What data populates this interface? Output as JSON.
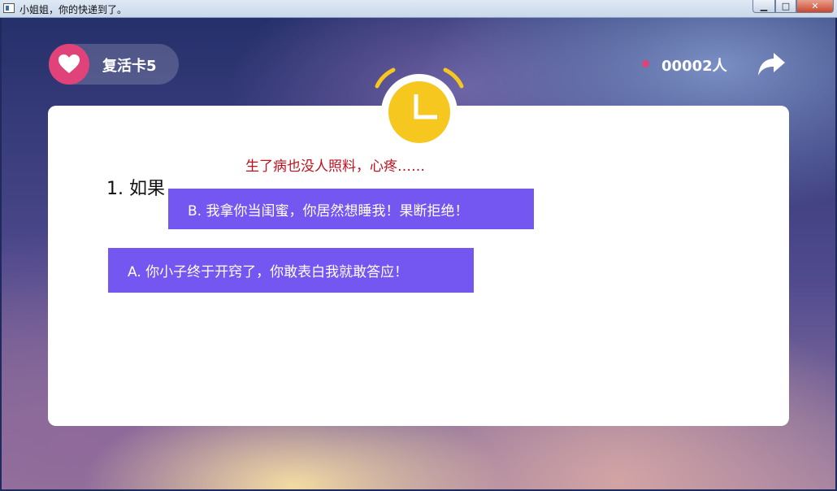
{
  "window": {
    "title": "小姐姐，你的快递到了。",
    "minimize": "▁",
    "maximize": "□",
    "close": "✕"
  },
  "header": {
    "revive_label": "复活卡5",
    "online_count": "00002人",
    "icons": {
      "heart": "heart-icon",
      "share": "share-icon",
      "timer": "alarm-clock-icon"
    }
  },
  "card": {
    "question": "1. 如果",
    "hint": "生了病也没人照料，心疼……",
    "options": [
      {
        "label": "B. 我拿你当闺蜜，你居然想睡我！果断拒绝！"
      },
      {
        "label": "A. 你小子终于开窍了，你敢表白我就敢答应！"
      }
    ]
  },
  "colors": {
    "accent_pink": "#e0427a",
    "option_purple": "#7456f0",
    "hint_red": "#c0101e",
    "timer_yellow": "#f6c71f"
  }
}
